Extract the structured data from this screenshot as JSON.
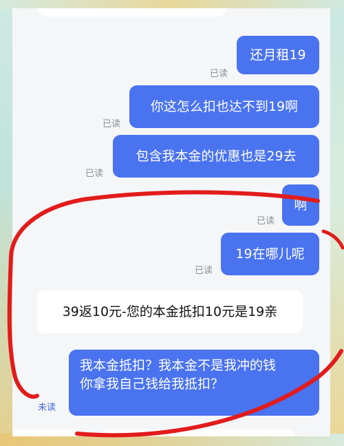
{
  "chat": {
    "messages": [
      {
        "side": "me",
        "text": "还月租19",
        "receipt": "已读"
      },
      {
        "side": "me",
        "text": "你这怎么扣也达不到19啊",
        "receipt": "已读"
      },
      {
        "side": "me",
        "text": "包含我本金的优惠也是29去",
        "receipt": "已读"
      },
      {
        "side": "me",
        "text": "啊",
        "receipt": "已读"
      },
      {
        "side": "me",
        "text": "19在哪儿呢",
        "receipt": "已读"
      },
      {
        "side": "other",
        "text": "39返10元-您的本金抵扣10元是19亲"
      },
      {
        "side": "me",
        "lines": [
          "我本金抵扣？我本金不是我冲的钱",
          "你拿我自己钱给我抵扣？"
        ],
        "receipt": "未读"
      }
    ]
  },
  "colors": {
    "my_bubble": "#4a73f0",
    "other_bubble": "#ffffff",
    "annotation": "#e21b1b",
    "read_receipt": "#8d8f96",
    "unread_receipt": "#3f67d8"
  }
}
